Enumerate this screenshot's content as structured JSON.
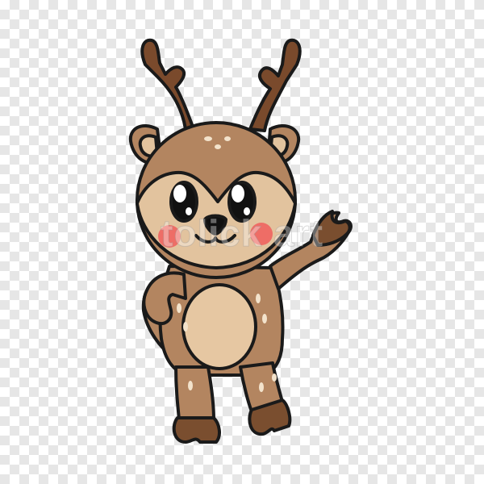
{
  "image": {
    "subject": "deer-character",
    "background": "transparency-checkerboard",
    "watermark_text": "tolick art"
  },
  "colors": {
    "outline": "#1a1a1a",
    "fur": "#b38560",
    "face": "#e2c39e",
    "belly": "#e6c7a2",
    "hoof": "#7a4e2f",
    "antler": "#7a4a2c",
    "ear_inner": "#e2c39e",
    "cheek": "#ee6d66",
    "spots": "#f3e3cc",
    "checker_light": "#ffffff",
    "checker_dark": "#e6e6e6"
  }
}
